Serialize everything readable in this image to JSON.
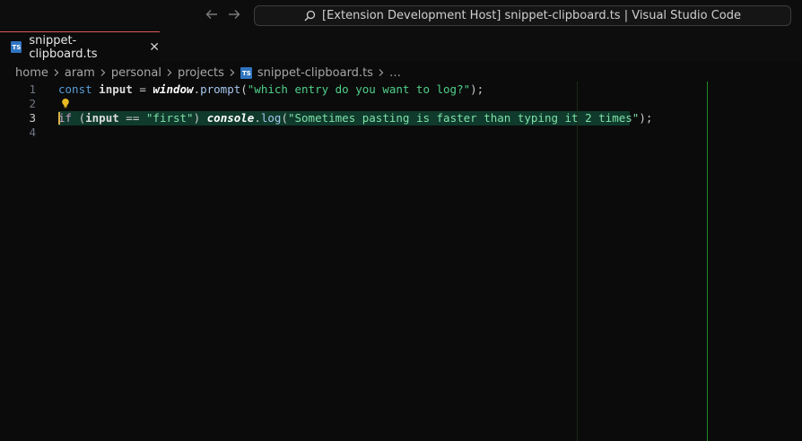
{
  "titlebar": {
    "command_center_text": "[Extension Development Host] snippet-clipboard.ts | Visual Studio Code",
    "back_icon": "arrow-left-icon",
    "forward_icon": "arrow-right-icon",
    "search_icon": "search-icon"
  },
  "tab": {
    "label": "snippet-clipboard.ts",
    "icon": "ts-icon",
    "icon_text": "TS",
    "close_glyph": "✕",
    "accent_color": "#e05a5a"
  },
  "breadcrumb": {
    "items": [
      "home",
      "aram",
      "personal",
      "projects",
      "snippet-clipboard.ts",
      "…"
    ]
  },
  "editor": {
    "active_line": 3,
    "lines": [
      {
        "number": "1"
      },
      {
        "number": "2"
      },
      {
        "number": "3"
      },
      {
        "number": "4"
      }
    ],
    "tokens": {
      "l1_const": "const",
      "l1_input": "input",
      "l1_eq": "=",
      "l1_window": "window",
      "l1_dot": ".",
      "l1_prompt": "prompt",
      "l1_open": "(",
      "l1_str": "\"which entry do you want to log?\"",
      "l1_close": ");",
      "l3_if": "if",
      "l3_open": "(",
      "l3_input": "input",
      "l3_eq": "==",
      "l3_first": "\"first\"",
      "l3_close": ")",
      "l3_console": "console",
      "l3_dot": ".",
      "l3_log": "log",
      "l3_open2": "(",
      "l3_str": "\"Sometimes pasting is faster than typing it 2 times\"",
      "l3_close2": ");"
    },
    "lightbulb_icon": "lightbulb-icon",
    "colors": {
      "selection": "#0f3a2c",
      "string": "#4fd08a",
      "keyword": "#569cd6"
    }
  }
}
